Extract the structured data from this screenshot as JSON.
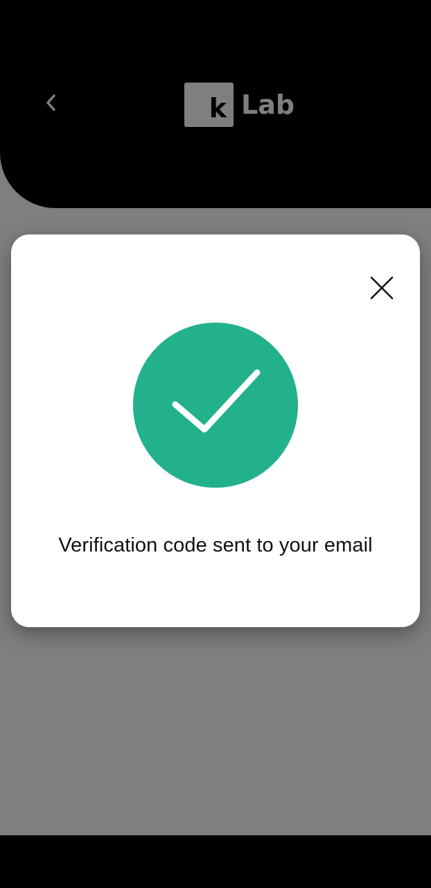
{
  "header": {
    "back_icon": "chevron-left-icon",
    "logo": {
      "mark": "k",
      "text": "Lab"
    }
  },
  "modal": {
    "close_icon": "close-icon",
    "status_icon": "checkmark-icon",
    "message": "Verification code sent to your email"
  },
  "colors": {
    "success": "#22b18b",
    "header_background": "#000000",
    "overlay": "rgba(0,0,0,0.5)"
  }
}
